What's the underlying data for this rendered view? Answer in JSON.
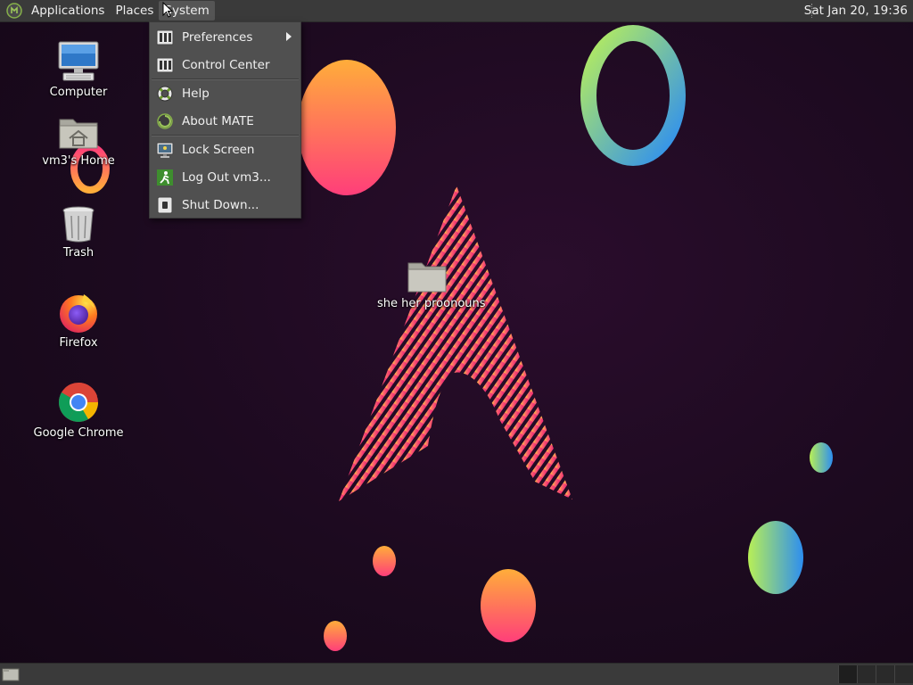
{
  "top_panel": {
    "menus": [
      "Applications",
      "Places",
      "System"
    ],
    "clock": "Sat Jan 20, 19:36"
  },
  "system_menu": {
    "items": [
      {
        "label": "Preferences",
        "icon": "preferences-icon",
        "submenu": true
      },
      {
        "label": "Control Center",
        "icon": "control-center-icon"
      },
      {
        "label": "Help",
        "icon": "help-lifebuoy-icon"
      },
      {
        "label": "About MATE",
        "icon": "mate-logo-icon"
      },
      {
        "label": "Lock Screen",
        "icon": "lock-screen-icon"
      },
      {
        "label": "Log Out vm3...",
        "icon": "log-out-icon"
      },
      {
        "label": "Shut Down...",
        "icon": "shut-down-icon"
      }
    ]
  },
  "desktop_icons": [
    {
      "label": "Computer",
      "icon": "computer-icon"
    },
    {
      "label": "vm3's Home",
      "icon": "home-folder-icon"
    },
    {
      "label": "Trash",
      "icon": "trash-icon"
    },
    {
      "label": "Firefox",
      "icon": "firefox-icon"
    },
    {
      "label": "Google Chrome",
      "icon": "chrome-icon"
    },
    {
      "label": "she her proonouns",
      "icon": "folder-icon"
    }
  ],
  "colors": {
    "panel": "#3a3a3a",
    "menu_bg": "#505050",
    "wallpaper": "#1c0a1f",
    "accent_pink": "#e0307a",
    "accent_orange": "#ff9a3c"
  }
}
